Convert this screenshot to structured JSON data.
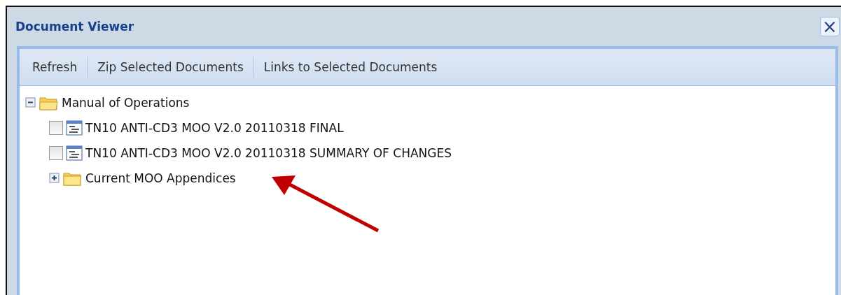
{
  "window": {
    "title": "Document Viewer",
    "close": "×"
  },
  "toolbar": [
    "Refresh",
    "Zip Selected Documents",
    "Links to Selected Documents"
  ],
  "tree": [
    {
      "label": "Manual of Operations",
      "kind": "folder",
      "expanded": true,
      "children": [
        {
          "label": "TN10 ANTI-CD3 MOO V2.0 20110318 FINAL",
          "kind": "document",
          "checked": false
        },
        {
          "label": "TN10 ANTI-CD3 MOO V2.0 20110318 SUMMARY OF CHANGES",
          "kind": "document",
          "checked": false
        },
        {
          "label": "Current MOO Appendices",
          "kind": "folder",
          "expanded": false
        }
      ]
    }
  ],
  "annotation": {
    "kind": "arrow"
  }
}
